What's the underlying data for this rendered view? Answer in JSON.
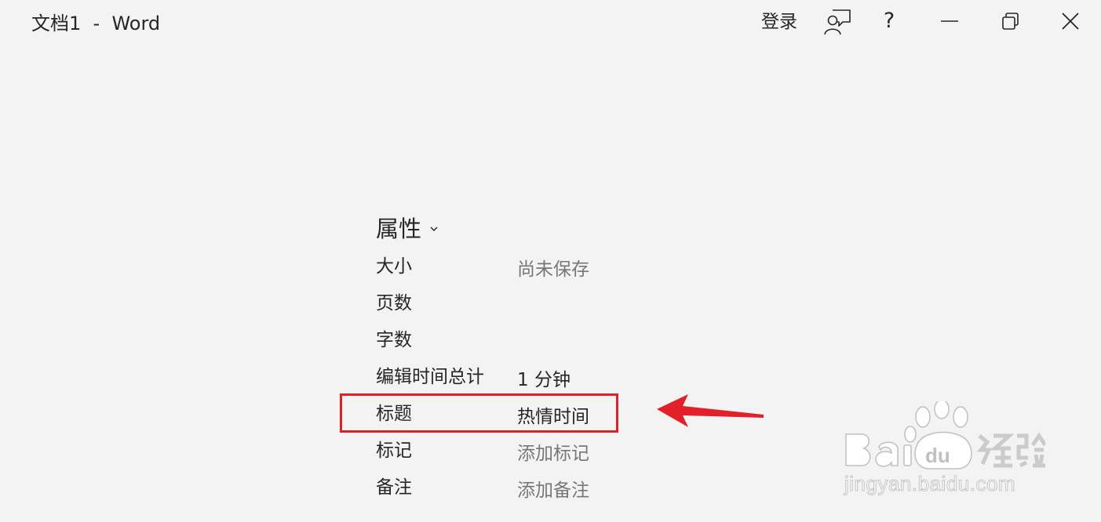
{
  "window": {
    "title": "文档1  -  Word",
    "signin_label": "登录",
    "help_label": "?"
  },
  "properties": {
    "header": "属性",
    "rows": [
      {
        "label": "大小",
        "value": "尚未保存"
      },
      {
        "label": "页数",
        "value": ""
      },
      {
        "label": "字数",
        "value": ""
      },
      {
        "label": "编辑时间总计",
        "value": "1 分钟"
      },
      {
        "label": "标题",
        "value": "热情时间"
      },
      {
        "label": "标记",
        "value": "添加标记"
      },
      {
        "label": "备注",
        "value": "添加备注"
      }
    ]
  },
  "annotation": {
    "highlight_color": "#e2202a"
  },
  "watermark": {
    "url": "jingyan.baidu.com"
  },
  "icons": {
    "feedback": "person-speech-icon",
    "minimize": "minimize-icon",
    "restore": "restore-icon",
    "close": "close-icon",
    "chevron": "chevron-down-icon"
  }
}
